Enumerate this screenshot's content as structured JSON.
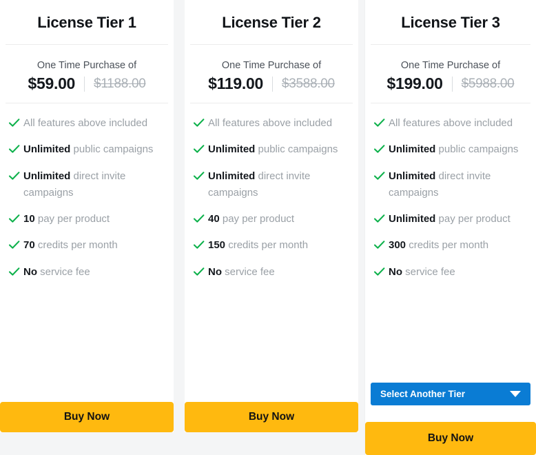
{
  "colors": {
    "check_green": "#0db14b",
    "buy_amber": "#ffb90f",
    "select_blue": "#0a7cd4",
    "page_bg": "#f4f5f6",
    "card_bg": "#ffffff",
    "muted_text": "#9aa0a6",
    "dark_text": "#14181d"
  },
  "tiers": [
    {
      "title": "License Tier 1",
      "price_label": "One Time Purchase of",
      "price_now": "$59.00",
      "price_was": "$1188.00",
      "features": [
        {
          "bold": "",
          "rest": "All features above included"
        },
        {
          "bold": "Unlimited",
          "rest": " public campaigns"
        },
        {
          "bold": "Unlimited",
          "rest": " direct invite campaigns"
        },
        {
          "bold": "10",
          "rest": " pay per product"
        },
        {
          "bold": "70",
          "rest": " credits per month"
        },
        {
          "bold": "No",
          "rest": " service fee"
        }
      ],
      "has_select": false,
      "select_label": "",
      "buy_label": "Buy Now"
    },
    {
      "title": "License Tier 2",
      "price_label": "One Time Purchase of",
      "price_now": "$119.00",
      "price_was": "$3588.00",
      "features": [
        {
          "bold": "",
          "rest": "All features above included"
        },
        {
          "bold": "Unlimited",
          "rest": " public campaigns"
        },
        {
          "bold": "Unlimited",
          "rest": " direct invite campaigns"
        },
        {
          "bold": "40",
          "rest": " pay per product"
        },
        {
          "bold": "150",
          "rest": " credits per month"
        },
        {
          "bold": "No",
          "rest": " service fee"
        }
      ],
      "has_select": false,
      "select_label": "",
      "buy_label": "Buy Now"
    },
    {
      "title": "License Tier 3",
      "price_label": "One Time Purchase of",
      "price_now": "$199.00",
      "price_was": "$5988.00",
      "features": [
        {
          "bold": "",
          "rest": "All features above included"
        },
        {
          "bold": "Unlimited",
          "rest": " public campaigns"
        },
        {
          "bold": "Unlimited",
          "rest": " direct invite campaigns"
        },
        {
          "bold": "Unlimited",
          "rest": " pay per product"
        },
        {
          "bold": "300",
          "rest": " credits per month"
        },
        {
          "bold": "No",
          "rest": " service fee"
        }
      ],
      "has_select": true,
      "select_label": "Select Another Tier",
      "buy_label": "Buy Now"
    }
  ]
}
